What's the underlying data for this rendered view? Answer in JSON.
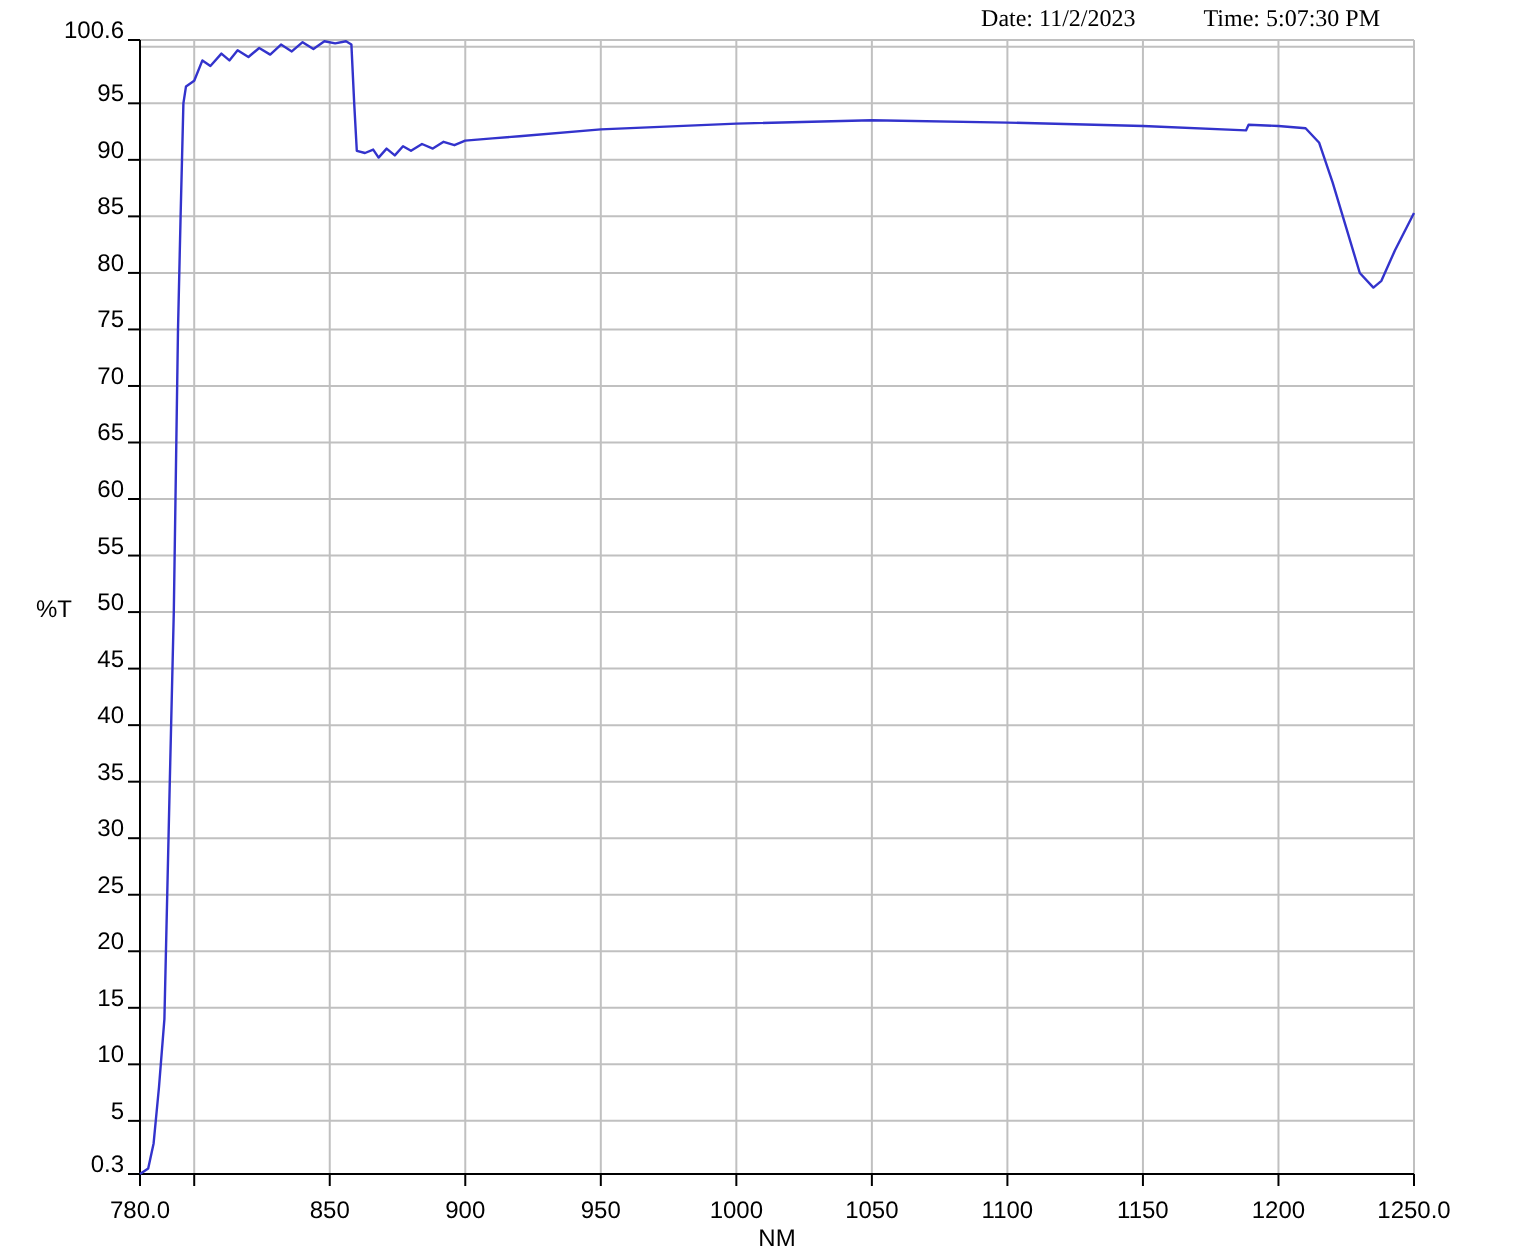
{
  "header": {
    "date": "Date: 11/2/2023",
    "time": "Time: 5:07:30 PM"
  },
  "chart": {
    "chart_data": {
      "type": "line",
      "grid": true,
      "xlabel": "NM",
      "ylabel": "%T",
      "xlim": [
        780,
        1250
      ],
      "ylim": [
        0.3,
        100.6
      ],
      "xticks": [
        {
          "value": 780,
          "label": "780.0"
        },
        850,
        900,
        950,
        1000,
        1050,
        1100,
        1150,
        1200,
        {
          "value": 1250,
          "label": "1250.0"
        }
      ],
      "yticks": [
        {
          "value": 0.3,
          "label": "0.3"
        },
        5,
        10,
        15,
        20,
        25,
        30,
        35,
        40,
        45,
        50,
        55,
        60,
        65,
        70,
        75,
        80,
        85,
        90,
        95,
        {
          "value": 100.6,
          "label": "100.6"
        }
      ],
      "x": [
        780,
        783,
        785,
        787,
        789,
        791,
        792.5,
        794,
        795,
        796,
        797,
        800,
        803,
        806,
        810,
        813,
        816,
        820,
        824,
        828,
        832,
        836,
        840,
        844,
        848,
        852,
        856,
        858,
        859,
        860,
        863,
        866,
        868,
        871,
        874,
        877,
        880,
        884,
        888,
        892,
        896,
        900,
        910,
        920,
        950,
        1000,
        1050,
        1100,
        1150,
        1188,
        1189,
        1200,
        1210,
        1215,
        1220,
        1225,
        1230,
        1235,
        1238,
        1243,
        1250
      ],
      "series": [
        {
          "color": "#3333cc",
          "values": [
            0.3,
            0.8,
            3,
            8,
            14,
            35,
            50,
            75,
            85,
            95,
            96.5,
            97,
            98.8,
            98.3,
            99.4,
            98.8,
            99.7,
            99.1,
            99.9,
            99.3,
            100.2,
            99.6,
            100.4,
            99.8,
            100.5,
            100.3,
            100.5,
            100.2,
            95,
            90.8,
            90.6,
            90.9,
            90.2,
            91,
            90.4,
            91.2,
            90.8,
            91.4,
            91,
            91.6,
            91.3,
            91.7,
            91.9,
            92.1,
            92.7,
            93.2,
            93.5,
            93.3,
            93,
            92.6,
            93.1,
            93,
            92.8,
            91.5,
            88,
            84,
            80,
            78.7,
            79.3,
            82,
            85.3
          ]
        }
      ]
    }
  }
}
